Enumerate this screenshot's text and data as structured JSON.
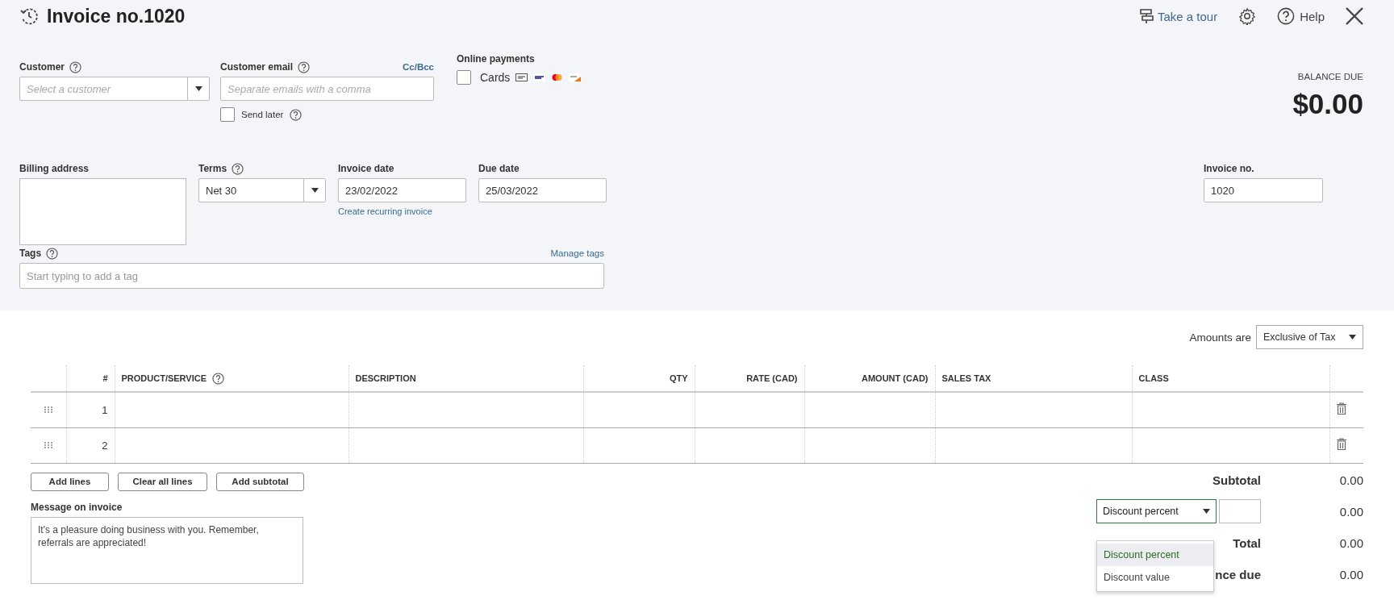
{
  "header": {
    "title": "Invoice no.1020",
    "tour": "Take a tour",
    "help": "Help"
  },
  "customer": {
    "label": "Customer",
    "placeholder": "Select a customer"
  },
  "email": {
    "label": "Customer email",
    "cc": "Cc/Bcc",
    "placeholder": "Separate emails with a comma",
    "send_later": {
      "label": "Send later",
      "checked": false
    }
  },
  "online_payments": {
    "label": "Online payments",
    "cards": {
      "label": "Cards",
      "checked": false
    }
  },
  "balance": {
    "label": "BALANCE DUE",
    "amount": "$0.00"
  },
  "billing_address": {
    "label": "Billing address"
  },
  "terms": {
    "label": "Terms",
    "value": "Net 30"
  },
  "invoice_date": {
    "label": "Invoice date",
    "value": "23/02/2022",
    "link": "Create recurring invoice"
  },
  "due_date": {
    "label": "Due date",
    "value": "25/03/2022"
  },
  "invoice_no": {
    "label": "Invoice no.",
    "value": "1020"
  },
  "tags": {
    "label": "Tags",
    "link": "Manage tags",
    "placeholder": "Start typing to add a tag"
  },
  "amounts": {
    "label": "Amounts are",
    "value": "Exclusive of Tax"
  },
  "table": {
    "columns": [
      {
        "label": "#",
        "help": false
      },
      {
        "label": "PRODUCT/SERVICE",
        "help": true
      },
      {
        "label": "DESCRIPTION",
        "help": false
      },
      {
        "label": "QTY",
        "help": false
      },
      {
        "label": "RATE (CAD)",
        "help": false
      },
      {
        "label": "AMOUNT (CAD)",
        "help": false
      },
      {
        "label": "SALES TAX",
        "help": false
      },
      {
        "label": "CLASS",
        "help": false
      }
    ],
    "rows": [
      {
        "number": "1"
      },
      {
        "number": "2"
      }
    ]
  },
  "buttons": [
    "Add lines",
    "Clear all lines",
    "Add subtotal"
  ],
  "message": {
    "label": "Message on invoice",
    "value": "It's a pleasure doing business with you.  Remember, referrals are appreciated!"
  },
  "totals": {
    "subtotal": {
      "label": "Subtotal",
      "value": "0.00"
    },
    "discount": {
      "mode": "Discount percent",
      "value": "0.00",
      "open": true,
      "options": [
        {
          "label": "Discount percent",
          "selected": true
        },
        {
          "label": "Discount value",
          "selected": false
        }
      ]
    },
    "total": {
      "label": "Total",
      "value": "0.00"
    },
    "balance_due": {
      "label": "nce due",
      "value": "0.00"
    }
  }
}
